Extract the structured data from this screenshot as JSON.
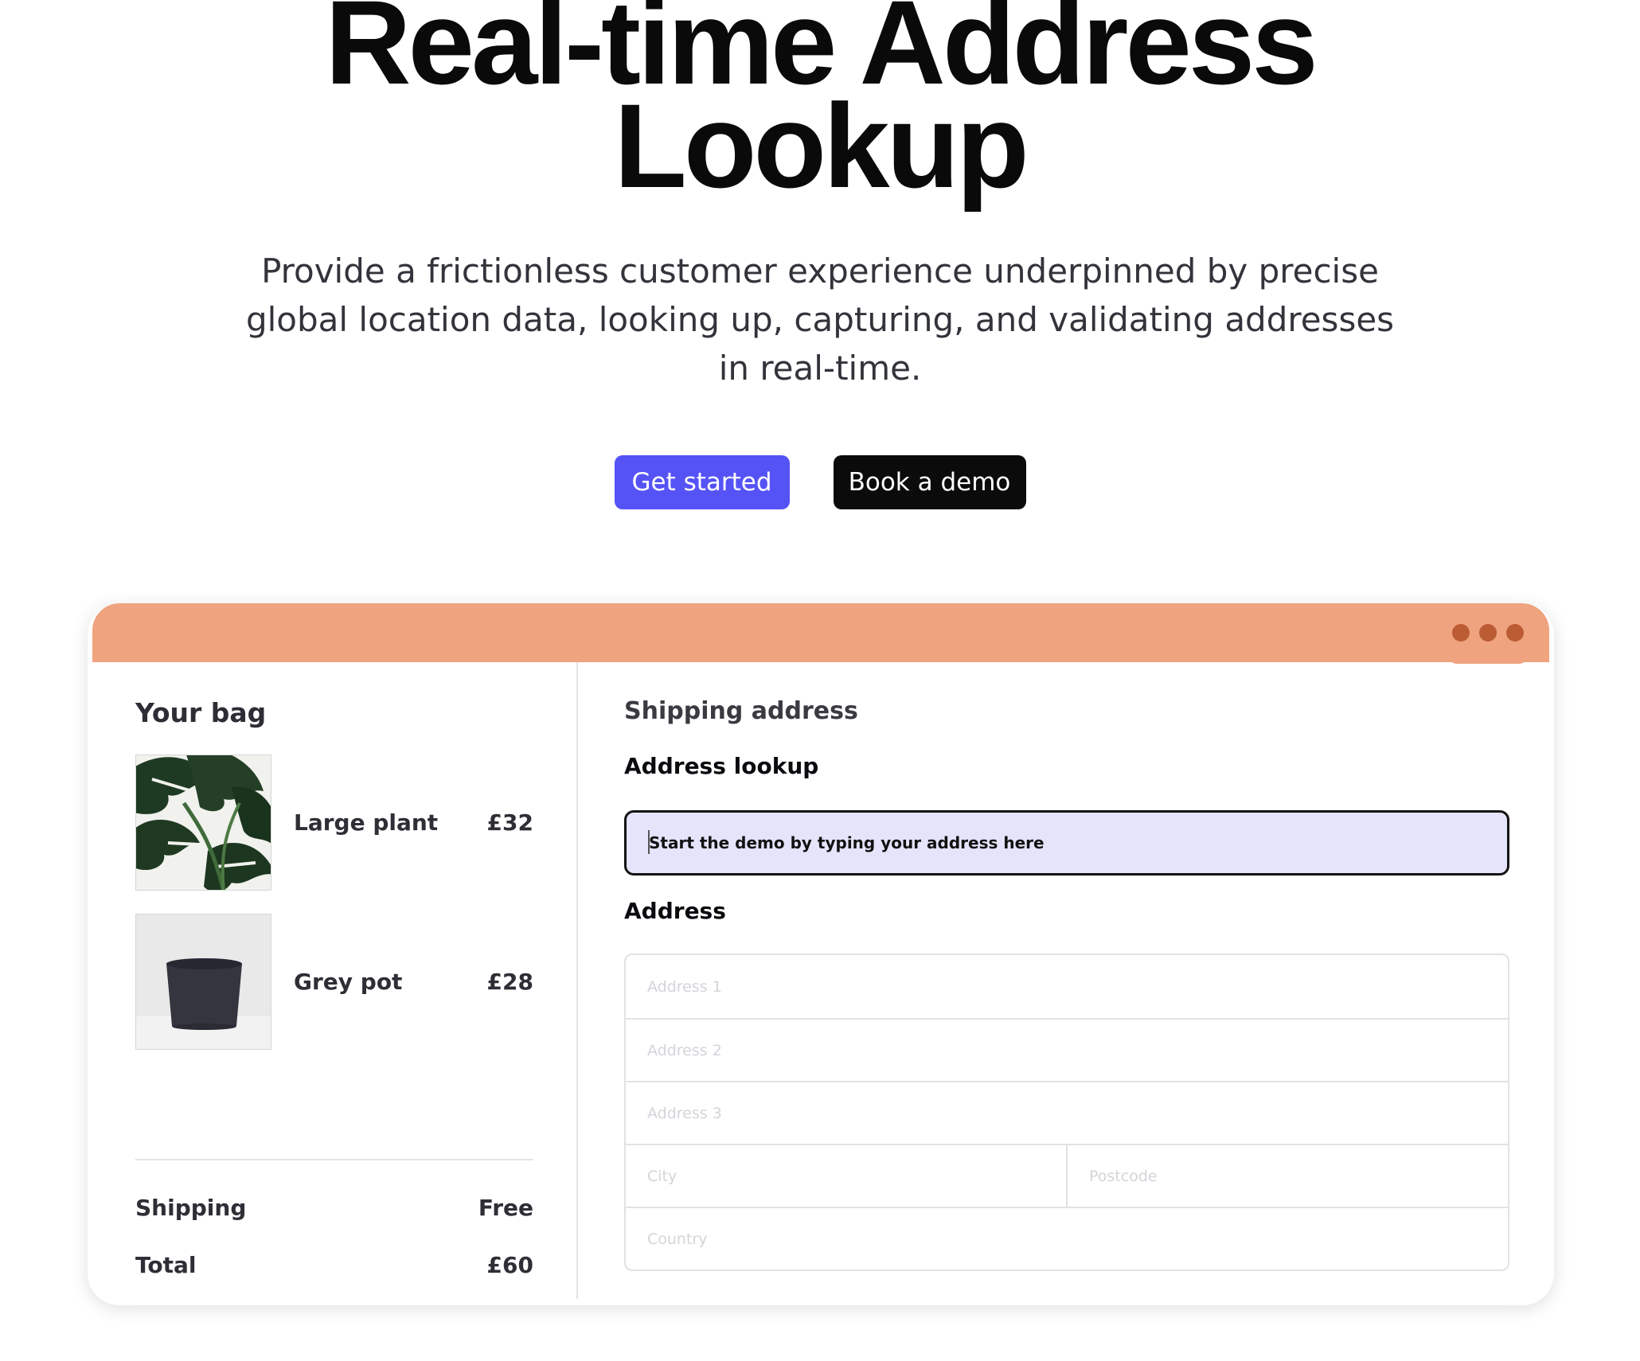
{
  "hero": {
    "title_line1": "Real-time Address",
    "title_line2": "Lookup",
    "subtitle": "Provide a frictionless customer experience underpinned by precise global location data, looking up, capturing, and validating addresses in real-time.",
    "primary_cta": "Get started",
    "secondary_cta": "Book a demo"
  },
  "colors": {
    "primary": "#5553f6",
    "demo_header": "#f0a37f",
    "lookup_field": "#e4e4fb"
  },
  "demo": {
    "window_controls": [
      "dot",
      "dot",
      "dot"
    ],
    "bag": {
      "title": "Your bag",
      "items": [
        {
          "name": "Large plant",
          "price": "£32",
          "image": "monstera-plant-photo"
        },
        {
          "name": "Grey pot",
          "price": "£28",
          "image": "grey-pot-photo"
        }
      ],
      "shipping_label": "Shipping",
      "shipping_value": "Free",
      "total_label": "Total",
      "total_value": "£60"
    },
    "shipping": {
      "title": "Shipping address",
      "lookup_label": "Address lookup",
      "lookup_value": "Start the demo by typing your address here",
      "address_label": "Address",
      "fields": {
        "address1": "Address 1",
        "address2": "Address 2",
        "address3": "Address 3",
        "city": "City",
        "postcode": "Postcode",
        "country": "Country"
      }
    }
  }
}
